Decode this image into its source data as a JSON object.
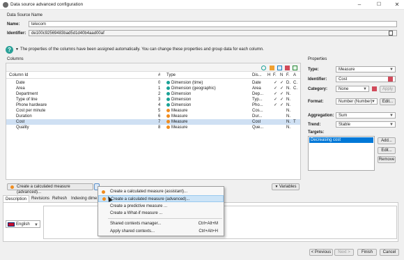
{
  "window": {
    "title": "Data source advanced configuration",
    "minimize": "–",
    "maximize": "☐",
    "close": "✕"
  },
  "datasource": {
    "section_label": "Data Source Name",
    "name_label": "Name:",
    "name_value": "telecom",
    "identifier_label": "Identifier:",
    "identifier_value": "de100c92569483bad5d1d40b4aad00af"
  },
  "info": {
    "text": "The properties of the columns have been assigned automatically. You can change these properties and group data for each column."
  },
  "columns": {
    "section_label": "Columns",
    "headers": {
      "id": "Column Id",
      "num": "#",
      "type": "Type",
      "dis": "Dis...",
      "h": "H",
      "f": "F.",
      "n": "N",
      "f2": "F.",
      "a": "A"
    },
    "rows": [
      {
        "id": "Date",
        "num": "0",
        "type": "Dimension (time)",
        "dot": "teal",
        "dis": "Date",
        "h": "",
        "f": "✓",
        "n": "✓",
        "f2": "D.",
        "a": "C."
      },
      {
        "id": "Area",
        "num": "1",
        "type": "Dimension (geographic)",
        "dot": "teal",
        "dis": "Area",
        "h": "",
        "f": "✓",
        "n": "✓",
        "f2": "N.",
        "a": "C."
      },
      {
        "id": "Department",
        "num": "2",
        "type": "Dimension",
        "dot": "teal",
        "dis": "Dep...",
        "h": "",
        "f": "✓",
        "n": "✓",
        "f2": "N.",
        "a": ""
      },
      {
        "id": "Type of line",
        "num": "3",
        "type": "Dimension",
        "dot": "teal",
        "dis": "Typ...",
        "h": "",
        "f": "✓",
        "n": "✓",
        "f2": "N.",
        "a": ""
      },
      {
        "id": "Phone hardware",
        "num": "4",
        "type": "Dimension",
        "dot": "teal",
        "dis": "Pho...",
        "h": "",
        "f": "✓",
        "n": "✓",
        "f2": "N.",
        "a": ""
      },
      {
        "id": "Cost per minute",
        "num": "5",
        "type": "Measure",
        "dot": "orange",
        "dis": "Cos...",
        "h": "",
        "f": "",
        "n": "",
        "f2": "N.",
        "a": ""
      },
      {
        "id": "Duration",
        "num": "6",
        "type": "Measure",
        "dot": "orange",
        "dis": "Dur...",
        "h": "",
        "f": "",
        "n": "",
        "f2": "N.",
        "a": ""
      },
      {
        "id": "Cost",
        "num": "7",
        "type": "Measure",
        "dot": "orange",
        "dis": "Cost",
        "h": "",
        "f": "",
        "n": "",
        "f2": "N.",
        "a": "T"
      },
      {
        "id": "Quality",
        "num": "8",
        "type": "Measure",
        "dot": "orange",
        "dis": "Que...",
        "h": "",
        "f": "",
        "n": "",
        "f2": "N.",
        "a": ""
      }
    ],
    "selected_index": 7,
    "calc_button": "Create a calculated measure (advanced)...",
    "variables_button": "Variables"
  },
  "menu": {
    "items": [
      {
        "label": "Create a calculated measure (assistant)...",
        "shortcut": "",
        "icon": "orange-dot"
      },
      {
        "label": "Create a calculated measure (advanced)...",
        "shortcut": "",
        "icon": "orange-dot"
      },
      {
        "label": "Create a predictive measure ...",
        "shortcut": "",
        "icon": ""
      },
      {
        "label": "Create a What-if measure ...",
        "shortcut": "",
        "icon": ""
      },
      {
        "label": "Shared contexts manager...",
        "shortcut": "Ctrl+Alt+M",
        "icon": ""
      },
      {
        "label": "Apply shared contexts...",
        "shortcut": "Ctrl+Alt+H",
        "icon": ""
      }
    ]
  },
  "tabs": [
    "Description",
    "Revisions",
    "Refresh",
    "Indexing dime"
  ],
  "language": {
    "value": "English"
  },
  "properties": {
    "section_label": "Properties",
    "type_label": "Type:",
    "type_value": "Measure",
    "identifier_label": "Identifier:",
    "identifier_value": "Cost",
    "category_label": "Category:",
    "category_value": "None",
    "apply_button": "Apply",
    "format_label": "Format:",
    "format_value": "Number (Number)",
    "edit_button": "Edit...",
    "aggregation_label": "Aggregation:",
    "aggregation_value": "Sum",
    "trend_label": "Trend:",
    "trend_value": "Stable",
    "targets_label": "Targets:",
    "targets_items": [
      "Decreasing cost"
    ],
    "add_button": "Add...",
    "targets_edit_button": "Edit...",
    "remove_button": "Remove"
  },
  "footer": {
    "previous": "< Previous",
    "next": "Next >",
    "finish": "Finish",
    "cancel": "Cancel"
  }
}
